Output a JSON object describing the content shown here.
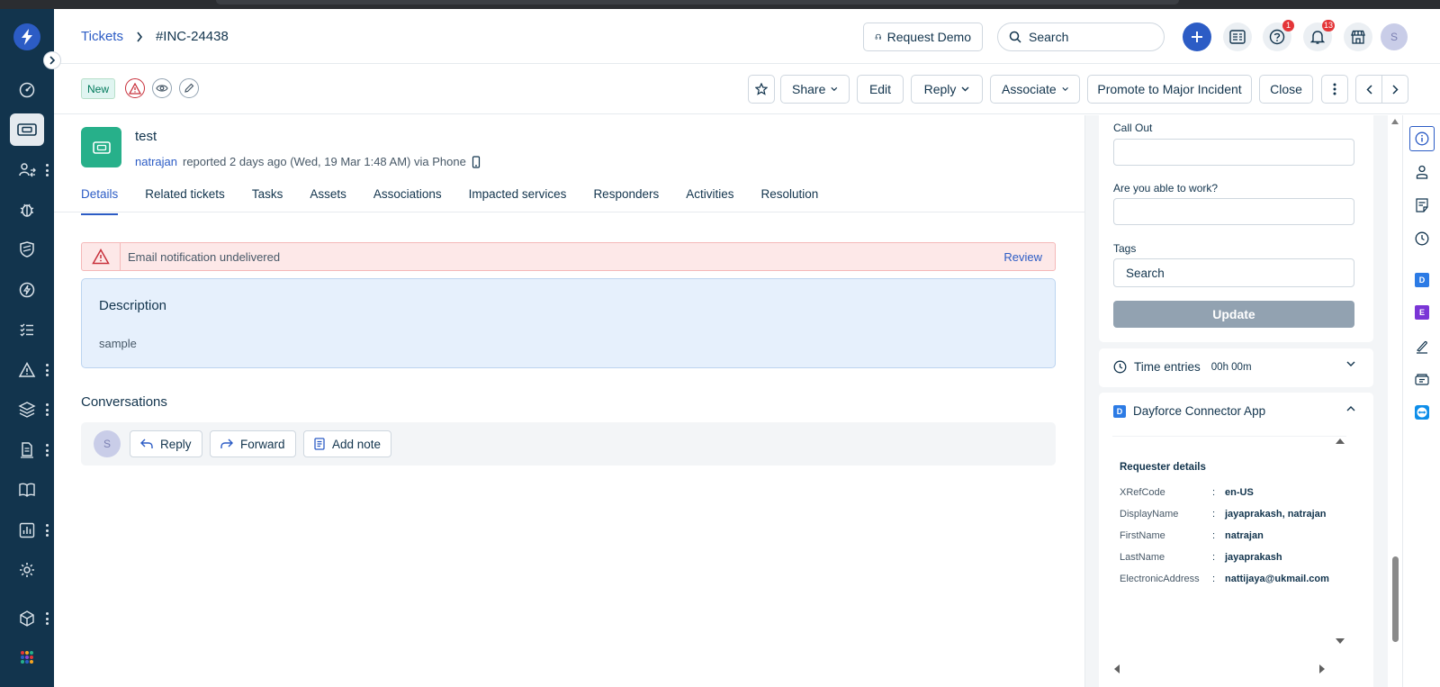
{
  "header": {
    "breadcrumb_root": "Tickets",
    "ticket_id": "#INC-24438",
    "request_demo": "Request Demo",
    "search_placeholder": "Search",
    "help_badge": "1",
    "notif_badge": "13",
    "avatar_initial": "S"
  },
  "toolbar": {
    "status": "New",
    "share": "Share",
    "edit": "Edit",
    "reply": "Reply",
    "associate": "Associate",
    "promote": "Promote to Major Incident",
    "close": "Close"
  },
  "ticket": {
    "title": "test",
    "requester": "natrajan",
    "meta": "reported 2 days ago (Wed, 19 Mar 1:48 AM) via Phone"
  },
  "tabs": [
    "Details",
    "Related tickets",
    "Tasks",
    "Assets",
    "Associations",
    "Impacted services",
    "Responders",
    "Activities",
    "Resolution"
  ],
  "alert": {
    "message": "Email notification undelivered",
    "action": "Review"
  },
  "description": {
    "title": "Description",
    "body": "sample"
  },
  "conversations": {
    "title": "Conversations",
    "avatar_initial": "S",
    "reply": "Reply",
    "forward": "Forward",
    "add_note": "Add note"
  },
  "properties": {
    "call_out_label": "Call Out",
    "call_out_value": "",
    "work_label": "Are you able to work?",
    "work_value": "",
    "tags_label": "Tags",
    "tags_placeholder": "Search",
    "update": "Update"
  },
  "time_entries": {
    "label": "Time entries",
    "value": "00h 00m"
  },
  "dayforce": {
    "title": "Dayforce Connector App",
    "icon_letter": "D",
    "section": "Requester details",
    "rows": [
      {
        "key": "XRefCode",
        "value": "en-US"
      },
      {
        "key": "DisplayName",
        "value": "jayaprakash, natrajan"
      },
      {
        "key": "FirstName",
        "value": "natrajan"
      },
      {
        "key": "LastName",
        "value": "jayaprakash"
      },
      {
        "key": "ElectronicAddress",
        "value": "nattijaya@ukmail.com"
      }
    ]
  },
  "appbar": {
    "d_letter": "D",
    "e_letter": "E"
  },
  "colors": {
    "sidebar": "#12344d",
    "accent": "#2c5cc5",
    "ticket_icon": "#27b08a",
    "alert_bg": "#fde8e8",
    "desc_bg": "#e6f0fc"
  }
}
